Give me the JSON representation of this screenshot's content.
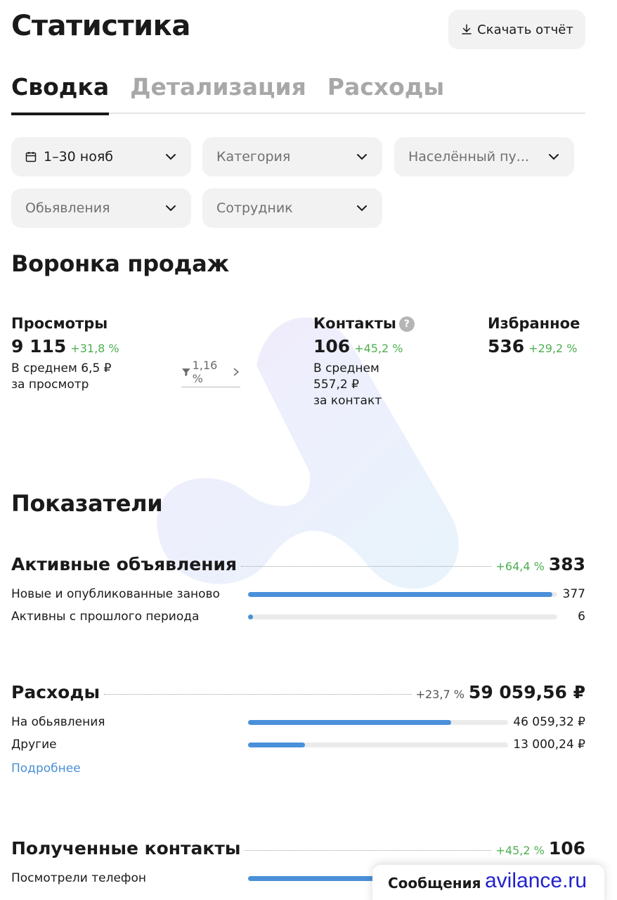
{
  "header": {
    "title": "Статистика",
    "download_label": "Скачать отчёт"
  },
  "tabs": [
    {
      "label": "Сводка",
      "active": true
    },
    {
      "label": "Детализация",
      "active": false
    },
    {
      "label": "Расходы",
      "active": false
    }
  ],
  "filters": {
    "period": "1–30 нояб",
    "category": "Категория",
    "locality": "Населённый пу...",
    "listings": "Обьявления",
    "employee": "Сотрудник"
  },
  "funnel": {
    "title": "Воронка продаж",
    "views": {
      "label": "Просмотры",
      "value": "9 115",
      "delta": "+31,8 %",
      "avg_line1": "В среднем 6,5 ₽",
      "avg_line2": "за просмотр"
    },
    "conversion": "1,16 %",
    "contacts": {
      "label": "Контакты",
      "value": "106",
      "delta": "+45,2 %",
      "avg_line1": "В среднем",
      "avg_line2": "557,2 ₽",
      "avg_line3": "за контакт"
    },
    "favorites": {
      "label": "Избранное",
      "value": "536",
      "delta": "+29,2 %"
    }
  },
  "indicators": {
    "title": "Показатели",
    "active_listings": {
      "label": "Активные объявления",
      "delta": "+64,4 %",
      "total": "383",
      "rows": [
        {
          "label": "Новые и опубликованные заново",
          "value": "377",
          "fill": 0.984
        },
        {
          "label": "Активны с прошлого периода",
          "value": "6",
          "fill": 0.016
        }
      ]
    },
    "expenses": {
      "label": "Расходы",
      "delta": "+23,7 %",
      "total": "59 059,56 ₽",
      "rows": [
        {
          "label": "На обьявления",
          "value": "46 059,32 ₽",
          "fill": 0.78
        },
        {
          "label": "Другие",
          "value": "13 000,24 ₽",
          "fill": 0.22
        }
      ],
      "more_link": "Подробнее"
    },
    "contacts": {
      "label": "Полученные контакты",
      "delta": "+45,2 %",
      "total": "106",
      "rows": [
        {
          "label": "Посмотрели телефон"
        }
      ]
    }
  },
  "messages_panel": {
    "label": "Сообщения"
  },
  "watermark_text": "avilance.ru",
  "colors": {
    "accent": "#4a90d9",
    "positive": "#4caf50",
    "link": "#4a8fd6"
  }
}
